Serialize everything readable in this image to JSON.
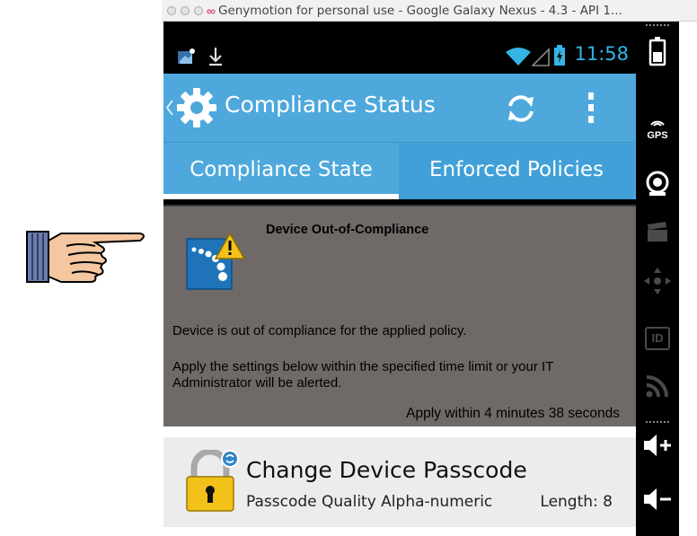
{
  "window": {
    "title": "Genymotion for personal use - Google Galaxy Nexus - 4.3 - API 1..."
  },
  "statusbar": {
    "time": "11:58"
  },
  "actionbar": {
    "title": "Compliance Status"
  },
  "tabs": [
    {
      "label": "Compliance State",
      "selected": true
    },
    {
      "label": "Enforced Policies",
      "selected": false
    }
  ],
  "alert": {
    "title": "Device Out-of-Compliance",
    "message": "Device is out of compliance for the applied policy.",
    "instruction": "Apply the settings below within the specified time limit or your IT Administrator will be alerted.",
    "timer_prefix": "Apply within",
    "timer_value": "4 minutes 38 seconds"
  },
  "policy": {
    "title": "Change Device Passcode",
    "detail": "Passcode Quality Alpha-numeric",
    "length": "Length: 8"
  },
  "sidebar": {
    "gps_label": "GPS",
    "id_label": "ID"
  },
  "colors": {
    "accent": "#4ea8dc",
    "holo_blue": "#33b5e5",
    "alert_bg": "#6f6a68",
    "row_bg": "#ececec"
  }
}
